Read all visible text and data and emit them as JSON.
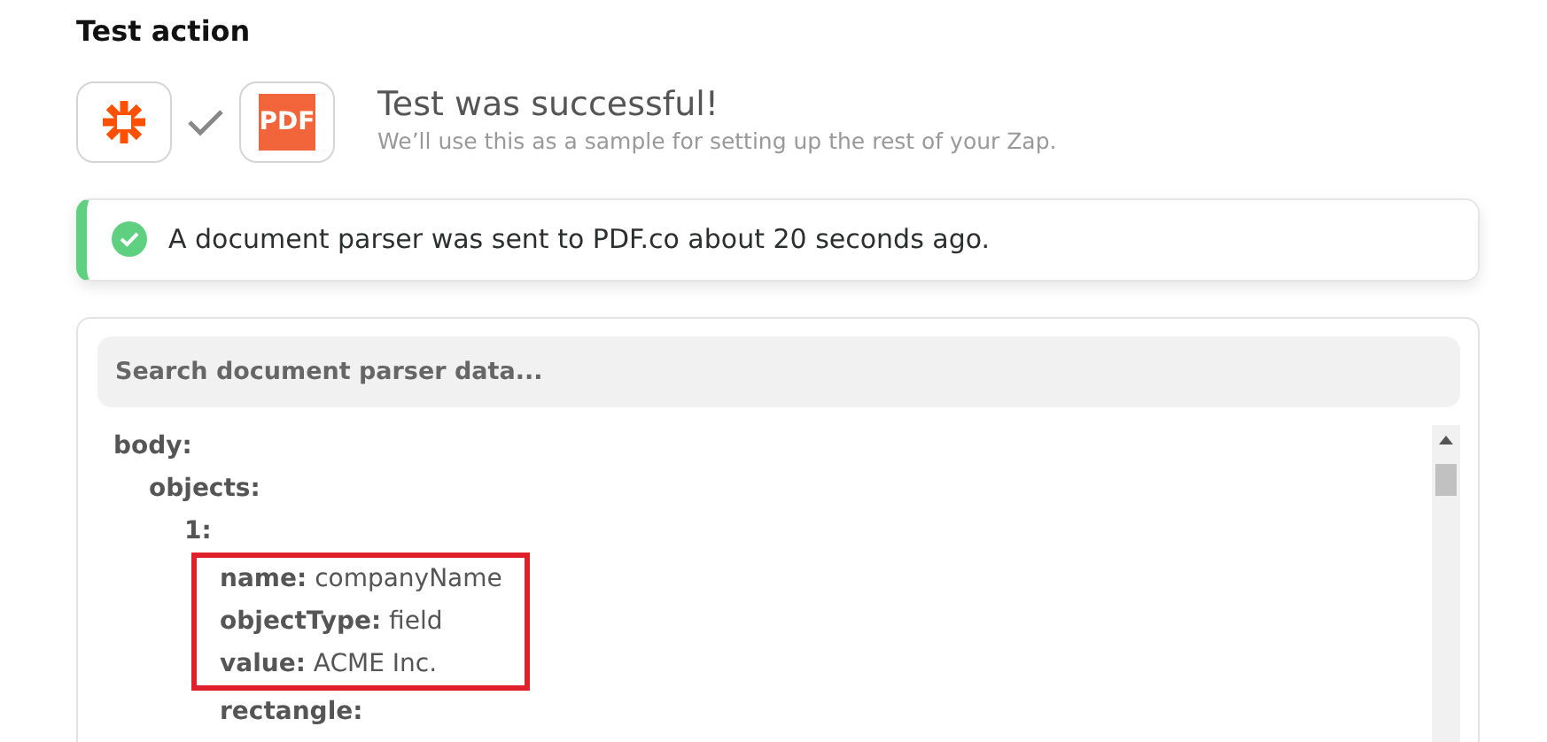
{
  "heading": "Test action",
  "apps": [
    {
      "kind": "zapier"
    },
    {
      "kind": "pdf",
      "label": "PDF"
    }
  ],
  "result": {
    "title": "Test was successful!",
    "subtitle": "We’ll use this as a sample for setting up the rest of your Zap."
  },
  "alert": {
    "text": "A document parser was sent to PDF.co about 20 seconds ago."
  },
  "search": {
    "placeholder": "Search document parser data..."
  },
  "tree": [
    {
      "key": "body:",
      "children": [
        {
          "key": "objects:",
          "children": [
            {
              "key": "1:",
              "children": [
                {
                  "key": "name:",
                  "value": "companyName",
                  "highlighted": true
                },
                {
                  "key": "objectType:",
                  "value": "field",
                  "highlighted": true
                },
                {
                  "key": "value:",
                  "value": "ACME Inc.",
                  "highlighted": true
                },
                {
                  "key": "rectangle:",
                  "highlighted": false
                }
              ]
            }
          ]
        }
      ]
    }
  ]
}
